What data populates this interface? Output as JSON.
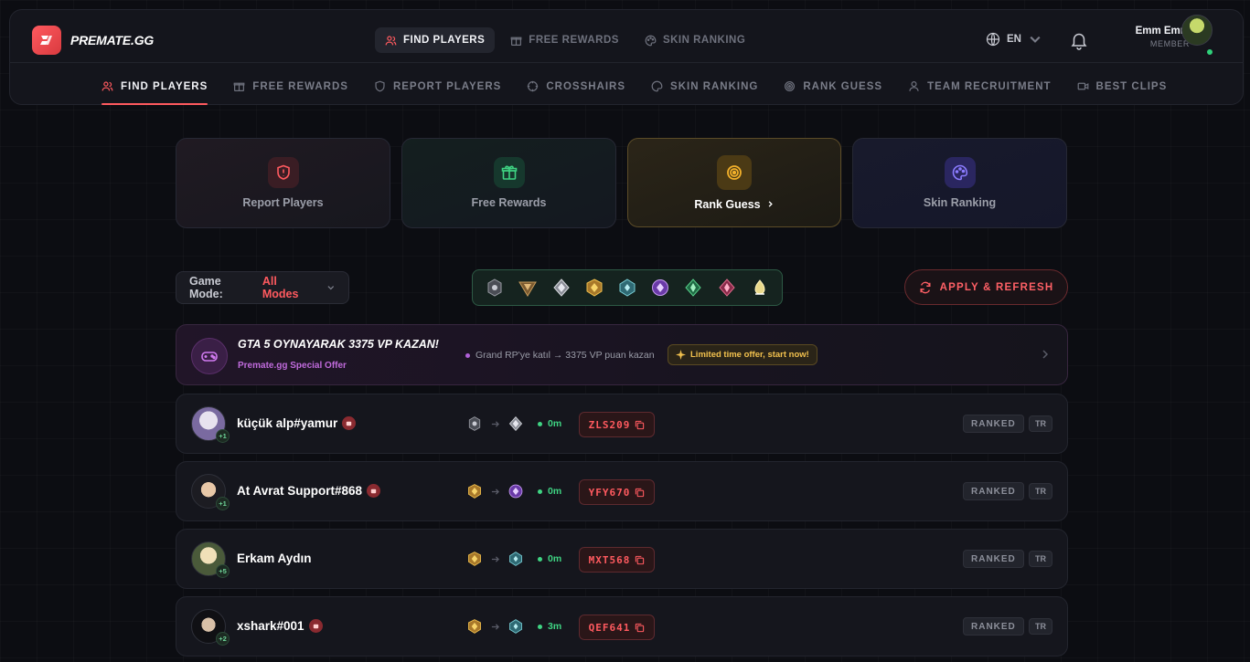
{
  "header": {
    "logo_text": "PREMATE.GG",
    "top_nav": [
      {
        "label": "FIND PLAYERS",
        "icon": "users-icon",
        "active": true
      },
      {
        "label": "FREE REWARDS",
        "icon": "gift-icon",
        "active": false
      },
      {
        "label": "SKIN RANKING",
        "icon": "palette-icon",
        "active": false
      }
    ],
    "language": "EN",
    "user": {
      "name": "Emm Emm",
      "role": "MEMBER"
    }
  },
  "sub_nav": [
    {
      "label": "FIND PLAYERS",
      "icon": "users-icon",
      "active": true
    },
    {
      "label": "FREE REWARDS",
      "icon": "gift-icon"
    },
    {
      "label": "REPORT PLAYERS",
      "icon": "shield-icon"
    },
    {
      "label": "CROSSHAIRS",
      "icon": "crosshair-icon"
    },
    {
      "label": "SKIN RANKING",
      "icon": "palette-icon"
    },
    {
      "label": "RANK GUESS",
      "icon": "target-icon"
    },
    {
      "label": "TEAM RECRUITMENT",
      "icon": "user-icon"
    },
    {
      "label": "BEST CLIPS",
      "icon": "video-icon"
    }
  ],
  "cards": [
    {
      "label": "Report Players"
    },
    {
      "label": "Free Rewards"
    },
    {
      "label": "Rank Guess"
    },
    {
      "label": "Skin Ranking"
    }
  ],
  "filters": {
    "game_mode_label": "Game Mode:",
    "game_mode_value": "All Modes",
    "apply_label": "APPLY & REFRESH"
  },
  "promo": {
    "title": "GTA 5 OYNAYARAK 3375 VP KAZAN!",
    "subtitle": "Premate.gg Special Offer",
    "description": "Grand RP'ye katıl → 3375 VP puan kazan",
    "badge": "Limited time offer, start now!"
  },
  "players": [
    {
      "name": "küçük alp#yamur",
      "extra": "+1",
      "time": "0m",
      "code": "ZLS209",
      "mode": "RANKED",
      "region": "TR",
      "has_flag": true
    },
    {
      "name": "At Avrat Support#868",
      "extra": "+1",
      "time": "0m",
      "code": "YFY670",
      "mode": "RANKED",
      "region": "TR",
      "has_flag": true
    },
    {
      "name": "Erkam Aydın",
      "extra": "+5",
      "time": "0m",
      "code": "MXT568",
      "mode": "RANKED",
      "region": "TR",
      "has_flag": false
    },
    {
      "name": "xshark#001",
      "extra": "+2",
      "time": "3m",
      "code": "QEF641",
      "mode": "RANKED",
      "region": "TR",
      "has_flag": true
    }
  ],
  "colors": {
    "accent": "#ff5a5f",
    "online": "#2fd07a"
  }
}
